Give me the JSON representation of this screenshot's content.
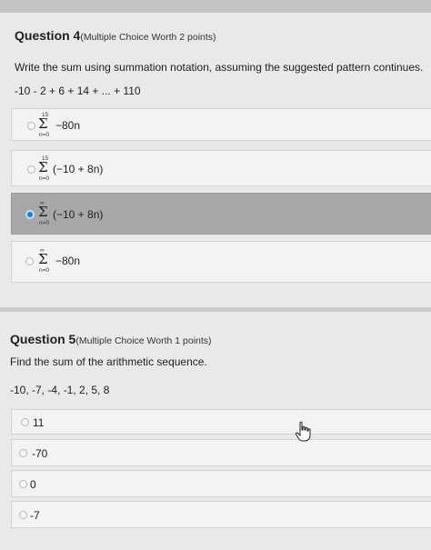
{
  "q4": {
    "title": "Question 4",
    "meta": "(Multiple Choice Worth 2 points)",
    "prompt": "Write the sum using summation notation, assuming the suggested pattern continues.",
    "sequence": "-10 - 2 + 6 + 14 + ... + 110",
    "options": [
      {
        "upper": "15",
        "sigma": "Σ",
        "lower": "n=0",
        "expr": "−80n",
        "selected": false
      },
      {
        "upper": "15",
        "sigma": "Σ",
        "lower": "n=0",
        "expr": "(−10 + 8n)",
        "selected": false
      },
      {
        "upper": "∞",
        "sigma": "Σ",
        "lower": "n=0",
        "expr": "(−10 + 8n)",
        "selected": true
      },
      {
        "upper": "∞",
        "sigma": "Σ",
        "lower": "n=0",
        "expr": "−80n",
        "selected": false
      }
    ]
  },
  "q5": {
    "title": "Question 5",
    "meta": "(Multiple Choice Worth 1 points)",
    "prompt": "Find the sum of the arithmetic sequence.",
    "sequence": "-10, -7, -4, -1, 2, 5, 8",
    "options": [
      {
        "label": "11"
      },
      {
        "label": "-70"
      },
      {
        "label": "0"
      },
      {
        "label": "-7"
      }
    ]
  },
  "colors": {
    "accent": "#1f7fd8",
    "selected_bg": "#a8a8a8"
  }
}
